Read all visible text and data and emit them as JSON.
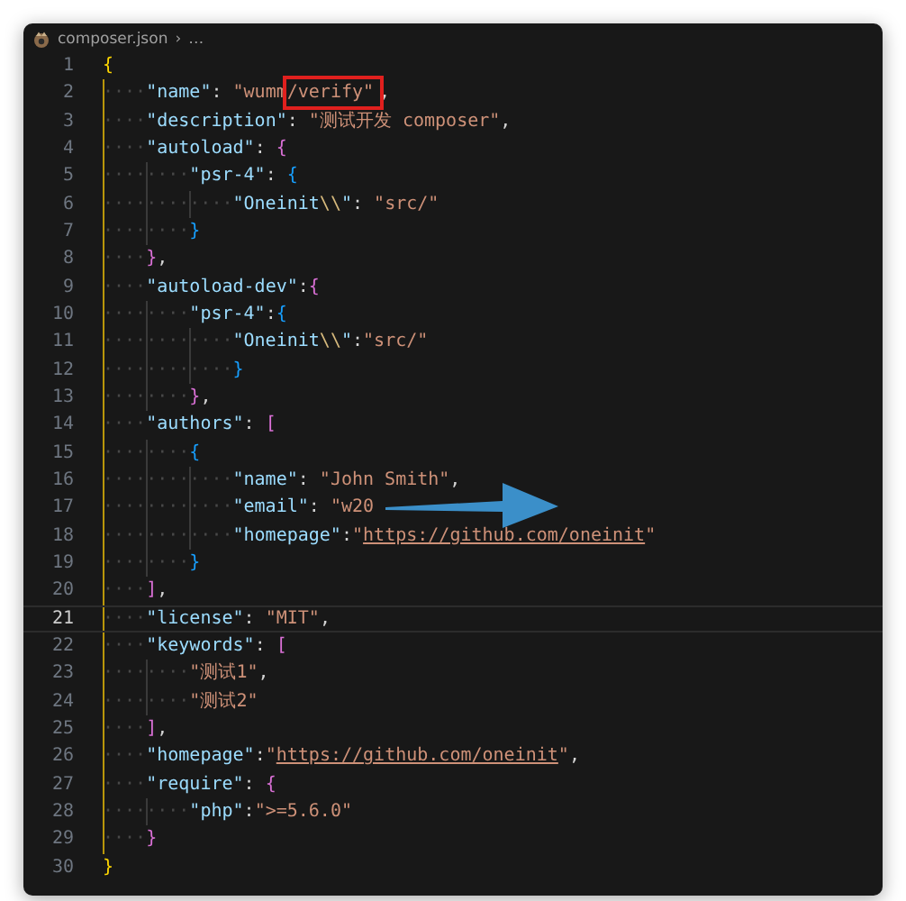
{
  "breadcrumb": {
    "file": "composer.json",
    "separator": "›",
    "rest": "…"
  },
  "lines": [
    {
      "n": "1",
      "current": false,
      "tokens": [
        {
          "kind": "b1",
          "text": "{"
        }
      ]
    },
    {
      "n": "2",
      "current": false,
      "tokens": [
        {
          "kind": "w",
          "text": "····"
        },
        {
          "kind": "k",
          "text": "\"name\""
        },
        {
          "kind": "p",
          "text": ": "
        },
        {
          "kind": "s",
          "text": "\"wumm"
        },
        {
          "kind": "s",
          "text": "/verify\"",
          "marked": true
        },
        {
          "kind": "p",
          "text": ","
        }
      ]
    },
    {
      "n": "3",
      "current": false,
      "tokens": [
        {
          "kind": "w",
          "text": "····"
        },
        {
          "kind": "k",
          "text": "\"description\""
        },
        {
          "kind": "p",
          "text": ": "
        },
        {
          "kind": "s",
          "text": "\"测试开发 composer\""
        },
        {
          "kind": "p",
          "text": ","
        }
      ]
    },
    {
      "n": "4",
      "current": false,
      "tokens": [
        {
          "kind": "w",
          "text": "····"
        },
        {
          "kind": "k",
          "text": "\"autoload\""
        },
        {
          "kind": "p",
          "text": ": "
        },
        {
          "kind": "b2",
          "text": "{"
        }
      ]
    },
    {
      "n": "5",
      "current": false,
      "tokens": [
        {
          "kind": "w",
          "text": "········"
        },
        {
          "kind": "k",
          "text": "\"psr-4\""
        },
        {
          "kind": "p",
          "text": ": "
        },
        {
          "kind": "b3",
          "text": "{"
        }
      ]
    },
    {
      "n": "6",
      "current": false,
      "tokens": [
        {
          "kind": "w",
          "text": "············"
        },
        {
          "kind": "k",
          "text": "\"Oneinit"
        },
        {
          "kind": "e",
          "text": "\\\\"
        },
        {
          "kind": "k",
          "text": "\""
        },
        {
          "kind": "p",
          "text": ": "
        },
        {
          "kind": "s",
          "text": "\"src/\""
        }
      ]
    },
    {
      "n": "7",
      "current": false,
      "tokens": [
        {
          "kind": "w",
          "text": "········"
        },
        {
          "kind": "b3",
          "text": "}"
        }
      ]
    },
    {
      "n": "8",
      "current": false,
      "tokens": [
        {
          "kind": "w",
          "text": "····"
        },
        {
          "kind": "b2",
          "text": "}"
        },
        {
          "kind": "p",
          "text": ","
        }
      ]
    },
    {
      "n": "9",
      "current": false,
      "tokens": [
        {
          "kind": "w",
          "text": "····"
        },
        {
          "kind": "k",
          "text": "\"autoload-dev\""
        },
        {
          "kind": "p",
          "text": ":"
        },
        {
          "kind": "b2",
          "text": "{"
        }
      ]
    },
    {
      "n": "10",
      "current": false,
      "tokens": [
        {
          "kind": "w",
          "text": "········"
        },
        {
          "kind": "k",
          "text": "\"psr-4\""
        },
        {
          "kind": "p",
          "text": ":"
        },
        {
          "kind": "b3",
          "text": "{"
        }
      ]
    },
    {
      "n": "11",
      "current": false,
      "tokens": [
        {
          "kind": "w",
          "text": "············"
        },
        {
          "kind": "k",
          "text": "\"Oneinit"
        },
        {
          "kind": "e",
          "text": "\\\\"
        },
        {
          "kind": "k",
          "text": "\""
        },
        {
          "kind": "p",
          "text": ":"
        },
        {
          "kind": "s",
          "text": "\"src/\""
        }
      ]
    },
    {
      "n": "12",
      "current": false,
      "tokens": [
        {
          "kind": "w",
          "text": "············"
        },
        {
          "kind": "b3",
          "text": "}"
        }
      ]
    },
    {
      "n": "13",
      "current": false,
      "tokens": [
        {
          "kind": "w",
          "text": "········"
        },
        {
          "kind": "b2",
          "text": "}"
        },
        {
          "kind": "p",
          "text": ","
        }
      ]
    },
    {
      "n": "14",
      "current": false,
      "tokens": [
        {
          "kind": "w",
          "text": "····"
        },
        {
          "kind": "k",
          "text": "\"authors\""
        },
        {
          "kind": "p",
          "text": ": "
        },
        {
          "kind": "b2",
          "text": "["
        }
      ]
    },
    {
      "n": "15",
      "current": false,
      "tokens": [
        {
          "kind": "w",
          "text": "········"
        },
        {
          "kind": "b3",
          "text": "{"
        }
      ]
    },
    {
      "n": "16",
      "current": false,
      "tokens": [
        {
          "kind": "w",
          "text": "············"
        },
        {
          "kind": "k",
          "text": "\"name\""
        },
        {
          "kind": "p",
          "text": ": "
        },
        {
          "kind": "s",
          "text": "\"John Smith\""
        },
        {
          "kind": "p",
          "text": ","
        }
      ]
    },
    {
      "n": "17",
      "current": false,
      "tokens": [
        {
          "kind": "w",
          "text": "············"
        },
        {
          "kind": "k",
          "text": "\"email\""
        },
        {
          "kind": "p",
          "text": ": "
        },
        {
          "kind": "s",
          "text": "\"w20"
        }
      ]
    },
    {
      "n": "18",
      "current": false,
      "tokens": [
        {
          "kind": "w",
          "text": "············"
        },
        {
          "kind": "k",
          "text": "\"homepage\""
        },
        {
          "kind": "p",
          "text": ":"
        },
        {
          "kind": "s",
          "text": "\""
        },
        {
          "kind": "u",
          "text": "https://github.com/oneinit"
        },
        {
          "kind": "s",
          "text": "\""
        }
      ]
    },
    {
      "n": "19",
      "current": false,
      "tokens": [
        {
          "kind": "w",
          "text": "········"
        },
        {
          "kind": "b3",
          "text": "}"
        }
      ]
    },
    {
      "n": "20",
      "current": false,
      "tokens": [
        {
          "kind": "w",
          "text": "····"
        },
        {
          "kind": "b2",
          "text": "]"
        },
        {
          "kind": "p",
          "text": ","
        }
      ]
    },
    {
      "n": "21",
      "current": true,
      "tokens": [
        {
          "kind": "w",
          "text": "····"
        },
        {
          "kind": "k",
          "text": "\"license\""
        },
        {
          "kind": "p",
          "text": ": "
        },
        {
          "kind": "s",
          "text": "\"MIT\""
        },
        {
          "kind": "p",
          "text": ","
        }
      ]
    },
    {
      "n": "22",
      "current": false,
      "tokens": [
        {
          "kind": "w",
          "text": "····"
        },
        {
          "kind": "k",
          "text": "\"keywords\""
        },
        {
          "kind": "p",
          "text": ": "
        },
        {
          "kind": "b2",
          "text": "["
        }
      ]
    },
    {
      "n": "23",
      "current": false,
      "tokens": [
        {
          "kind": "w",
          "text": "········"
        },
        {
          "kind": "s",
          "text": "\"测试1\""
        },
        {
          "kind": "p",
          "text": ","
        }
      ]
    },
    {
      "n": "24",
      "current": false,
      "tokens": [
        {
          "kind": "w",
          "text": "········"
        },
        {
          "kind": "s",
          "text": "\"测试2\""
        }
      ]
    },
    {
      "n": "25",
      "current": false,
      "tokens": [
        {
          "kind": "w",
          "text": "····"
        },
        {
          "kind": "b2",
          "text": "]"
        },
        {
          "kind": "p",
          "text": ","
        }
      ]
    },
    {
      "n": "26",
      "current": false,
      "tokens": [
        {
          "kind": "w",
          "text": "····"
        },
        {
          "kind": "k",
          "text": "\"homepage\""
        },
        {
          "kind": "p",
          "text": ":"
        },
        {
          "kind": "s",
          "text": "\""
        },
        {
          "kind": "u",
          "text": "https://github.com/oneinit"
        },
        {
          "kind": "s",
          "text": "\""
        },
        {
          "kind": "p",
          "text": ","
        }
      ]
    },
    {
      "n": "27",
      "current": false,
      "tokens": [
        {
          "kind": "w",
          "text": "····"
        },
        {
          "kind": "k",
          "text": "\"require\""
        },
        {
          "kind": "p",
          "text": ": "
        },
        {
          "kind": "b2",
          "text": "{"
        }
      ]
    },
    {
      "n": "28",
      "current": false,
      "tokens": [
        {
          "kind": "w",
          "text": "········"
        },
        {
          "kind": "k",
          "text": "\"php\""
        },
        {
          "kind": "p",
          "text": ":"
        },
        {
          "kind": "s",
          "text": "\">=5.6.0\""
        }
      ]
    },
    {
      "n": "29",
      "current": false,
      "tokens": [
        {
          "kind": "w",
          "text": "····"
        },
        {
          "kind": "b2",
          "text": "}"
        }
      ]
    },
    {
      "n": "30",
      "current": false,
      "tokens": [
        {
          "kind": "b1",
          "text": "}"
        }
      ]
    }
  ]
}
